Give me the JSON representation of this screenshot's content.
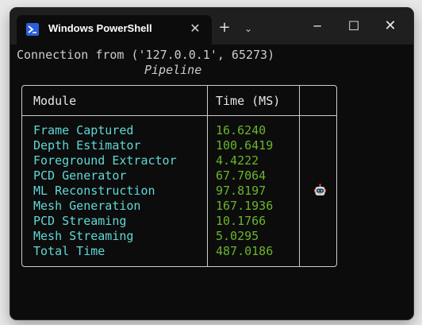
{
  "window": {
    "tab_title": "Windows PowerShell",
    "tab_icon": "powershell-icon",
    "close_tab_glyph": "✕",
    "new_tab_glyph": "+",
    "dropdown_glyph": "⌄",
    "minimize_glyph": "─",
    "maximize_glyph": "☐",
    "close_glyph": "✕"
  },
  "console": {
    "connection_line": "Connection from ('127.0.0.1', 65273)",
    "table_title": "Pipeline",
    "headers": {
      "module": "Module",
      "time": "Time (MS)"
    },
    "rows": [
      {
        "module": "Frame Captured",
        "time": "16.6240"
      },
      {
        "module": "Depth Estimator",
        "time": "100.6419"
      },
      {
        "module": "Foreground Extractor",
        "time": "4.4222"
      },
      {
        "module": "PCD Generator",
        "time": "67.7064"
      },
      {
        "module": "ML Reconstruction",
        "time": "97.8197"
      },
      {
        "module": "Mesh Generation",
        "time": "167.1936"
      },
      {
        "module": "PCD Streaming",
        "time": "10.1766"
      },
      {
        "module": "Mesh Streaming",
        "time": "5.0295"
      },
      {
        "module": "Total Time",
        "time": "487.0186"
      }
    ],
    "status_icon": "robot-icon"
  },
  "colors": {
    "background": "#0c0c0c",
    "titlebar": "#1f1f1f",
    "module_text": "#61d6d6",
    "time_text": "#6ab42d",
    "default_text": "#cccccc"
  }
}
